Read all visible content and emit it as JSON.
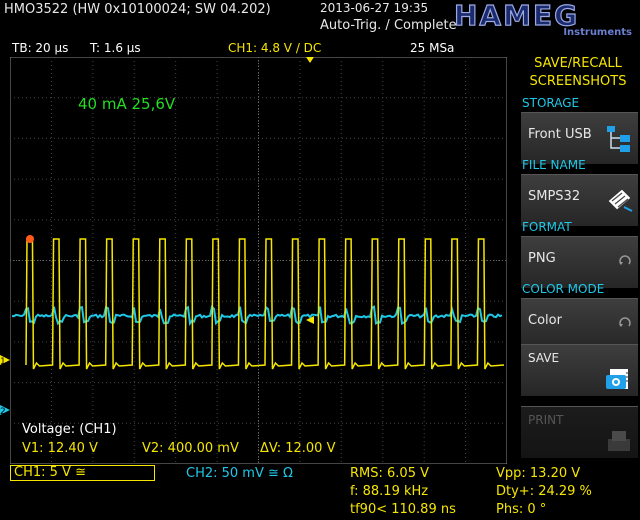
{
  "header": {
    "device_id": "HMO3522 (HW 0x10100024; SW 04.202)",
    "datetime": "2013-06-27 19:35",
    "trigger_status": "Auto-Trig. / Complete",
    "logo_text": "HAMEG",
    "logo_sub": "Instruments"
  },
  "settings": {
    "timebase": "TB: 20 µs",
    "trigger_delay": "T: 1.6 µs",
    "ch1_trigger": "CH1: 4.8 V / DC",
    "sample_rate": "25 MSa"
  },
  "screen": {
    "annotation": "40 mA 25,6V",
    "cursor_title": "Voltage: (CH1)",
    "cursor_v1": "V1: 12.40 V",
    "cursor_v2": "V2: 400.00 mV",
    "cursor_dv": "ΔV: 12.00 V",
    "ch1_marker": "1",
    "ch2_marker": "2"
  },
  "channels": {
    "ch1": "CH1: 5 V ≅",
    "ch2": "CH2: 50 mV ≅ Ω"
  },
  "measurements": {
    "rms": "RMS: 6.05 V",
    "freq": "f: 88.19 kHz",
    "tf90": "tf90< 110.89 ns",
    "vpp": "Vpp: 13.20 V",
    "duty": "Dty+: 24.29 %",
    "phase": "Phs: 0 °"
  },
  "panel": {
    "title": "SAVE/RECALL SCREENSHOTS",
    "storage_heading": "STORAGE",
    "storage_value": "Front USB",
    "filename_heading": "FILE NAME",
    "filename_value": "SMPS32",
    "format_heading": "FORMAT",
    "format_value": "PNG",
    "color_heading": "COLOR MODE",
    "color_value": "Color",
    "save_label": "SAVE",
    "print_label": "PRINT"
  },
  "colors": {
    "ch1": "#f5e600",
    "ch2": "#1fc8e8",
    "annotation": "#22dd22",
    "trigger_marker": "#ff5a1a"
  },
  "waveform": {
    "ch1_pulse_count": 18,
    "ch1_duty_percent": 24.29
  }
}
